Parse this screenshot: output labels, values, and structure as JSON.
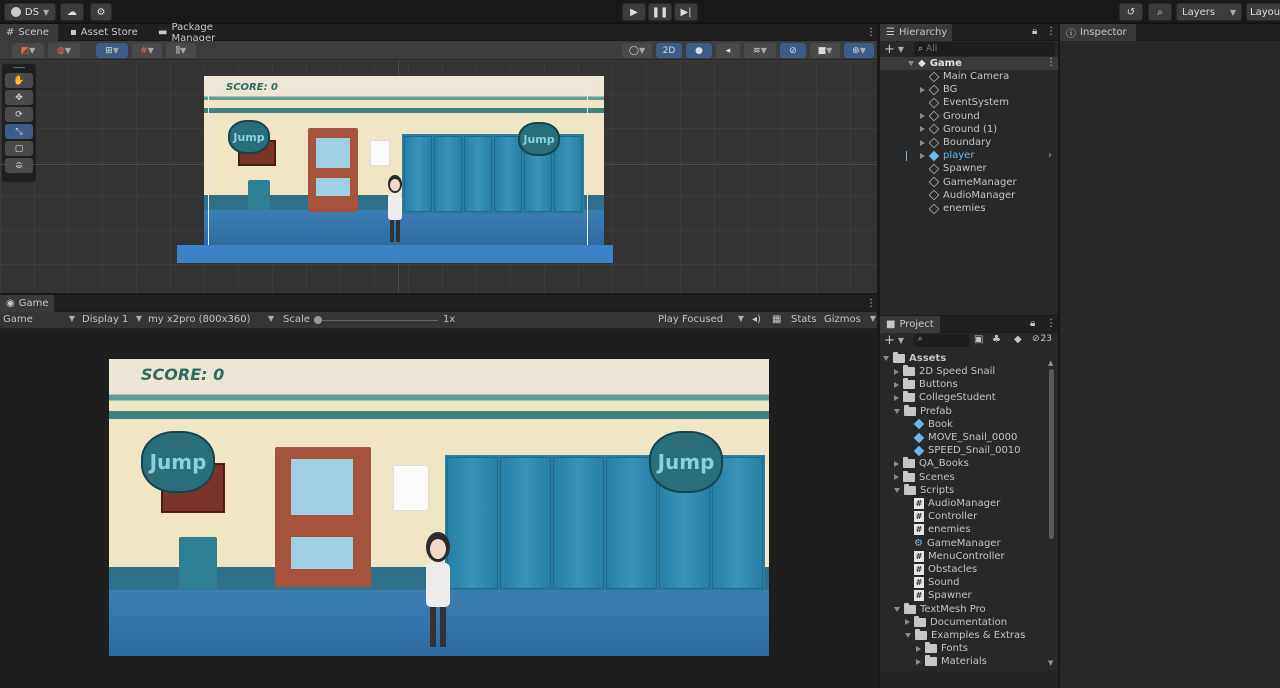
{
  "topbar": {
    "account": "DS",
    "layers": "Layers",
    "layout": "Layout"
  },
  "scene_panel": {
    "tabs": [
      "Scene",
      "Asset Store",
      "Package Manager"
    ],
    "btn_2d": "2D"
  },
  "game_panel": {
    "tab": "Game",
    "display_mode": "Game",
    "display": "Display 1",
    "resolution": "my x2pro (800x360)",
    "scale_label": "Scale",
    "scale_value": "1x",
    "play_mode": "Play Focused",
    "stats": "Stats",
    "gizmos": "Gizmos"
  },
  "game_view": {
    "score": "SCORE: 0",
    "jump_left": "Jump",
    "jump_right": "Jump"
  },
  "hierarchy": {
    "title": "Hierarchy",
    "search_placeholder": "All",
    "scene_name": "Game",
    "items": [
      {
        "label": "Main Camera",
        "arrow": false,
        "color": "#c4c4c4"
      },
      {
        "label": "BG",
        "arrow": true,
        "color": "#c4c4c4"
      },
      {
        "label": "EventSystem",
        "arrow": false,
        "color": "#c4c4c4"
      },
      {
        "label": "Ground",
        "arrow": true,
        "color": "#c4c4c4"
      },
      {
        "label": "Ground (1)",
        "arrow": true,
        "color": "#c4c4c4"
      },
      {
        "label": "Boundary",
        "arrow": true,
        "color": "#c4c4c4"
      },
      {
        "label": "player",
        "arrow": true,
        "color": "#6fb7e8"
      },
      {
        "label": "Spawner",
        "arrow": false,
        "color": "#c4c4c4"
      },
      {
        "label": "GameManager",
        "arrow": false,
        "color": "#c4c4c4"
      },
      {
        "label": "AudioManager",
        "arrow": false,
        "color": "#c4c4c4"
      },
      {
        "label": "enemies",
        "arrow": false,
        "color": "#c4c4c4"
      }
    ]
  },
  "project": {
    "title": "Project",
    "hidden_count": "23",
    "root": "Assets",
    "items": [
      {
        "label": "2D Speed Snail",
        "icon": "folder",
        "arrow": "right",
        "indent": 1
      },
      {
        "label": "Buttons",
        "icon": "folder",
        "arrow": "right",
        "indent": 1
      },
      {
        "label": "CollegeStudent",
        "icon": "folder",
        "arrow": "right",
        "indent": 1
      },
      {
        "label": "Prefab",
        "icon": "folder",
        "arrow": "down",
        "indent": 1
      },
      {
        "label": "Book",
        "icon": "prefab",
        "arrow": "none",
        "indent": 2
      },
      {
        "label": "MOVE_Snail_0000",
        "icon": "prefab",
        "arrow": "none",
        "indent": 2
      },
      {
        "label": "SPEED_Snail_0010",
        "icon": "prefab",
        "arrow": "none",
        "indent": 2
      },
      {
        "label": "QA_Books",
        "icon": "folder",
        "arrow": "right",
        "indent": 1
      },
      {
        "label": "Scenes",
        "icon": "folder",
        "arrow": "right",
        "indent": 1
      },
      {
        "label": "Scripts",
        "icon": "folder",
        "arrow": "down",
        "indent": 1
      },
      {
        "label": "AudioManager",
        "icon": "script",
        "arrow": "none",
        "indent": 2
      },
      {
        "label": "Controller",
        "icon": "script",
        "arrow": "none",
        "indent": 2
      },
      {
        "label": "enemies",
        "icon": "script",
        "arrow": "none",
        "indent": 2
      },
      {
        "label": "GameManager",
        "icon": "gear",
        "arrow": "none",
        "indent": 2
      },
      {
        "label": "MenuController",
        "icon": "script",
        "arrow": "none",
        "indent": 2
      },
      {
        "label": "Obstacles",
        "icon": "script",
        "arrow": "none",
        "indent": 2
      },
      {
        "label": "Sound",
        "icon": "script",
        "arrow": "none",
        "indent": 2
      },
      {
        "label": "Spawner",
        "icon": "script",
        "arrow": "none",
        "indent": 2
      },
      {
        "label": "TextMesh Pro",
        "icon": "folder",
        "arrow": "down",
        "indent": 1
      },
      {
        "label": "Documentation",
        "icon": "folder",
        "arrow": "right",
        "indent": 2
      },
      {
        "label": "Examples & Extras",
        "icon": "folder",
        "arrow": "down",
        "indent": 2
      },
      {
        "label": "Fonts",
        "icon": "folder",
        "arrow": "right",
        "indent": 3
      },
      {
        "label": "Materials",
        "icon": "folder",
        "arrow": "right",
        "indent": 3
      }
    ]
  },
  "inspector": {
    "title": "Inspector"
  }
}
